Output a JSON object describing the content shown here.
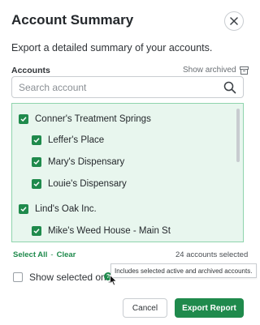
{
  "dialog": {
    "title": "Account Summary",
    "subtitle": "Export a detailed summary of your accounts.",
    "close_icon": "close-icon"
  },
  "accounts": {
    "label": "Accounts",
    "show_archived_label": "Show archived",
    "archive_icon": "archive-box-icon"
  },
  "search": {
    "placeholder": "Search account",
    "value": "",
    "icon": "search-icon"
  },
  "tree": [
    {
      "label": "Conner's Treatment Springs",
      "level": "parent",
      "checked": true
    },
    {
      "label": "Leffer's Place",
      "level": "child",
      "checked": true
    },
    {
      "label": "Mary's Dispensary",
      "level": "child",
      "checked": true
    },
    {
      "label": "Louie's Dispensary",
      "level": "child",
      "checked": true
    },
    {
      "label": "Lind's Oak Inc.",
      "level": "parent",
      "checked": true
    },
    {
      "label": "Mike's Weed House - Main St",
      "level": "child",
      "checked": true
    }
  ],
  "selection": {
    "select_all": "Select All",
    "separator": "-",
    "clear": "Clear",
    "count_text": "24 accounts selected"
  },
  "show_selected": {
    "label": "Show selected only",
    "checked": false,
    "help_icon": "help-icon"
  },
  "tooltip": {
    "text": "Includes selected active and archived accounts."
  },
  "buttons": {
    "cancel": "Cancel",
    "export": "Export Report"
  },
  "colors": {
    "accent": "#1f8a4c",
    "list_background": "#e8f6ee",
    "list_border": "#8fd4ad"
  }
}
